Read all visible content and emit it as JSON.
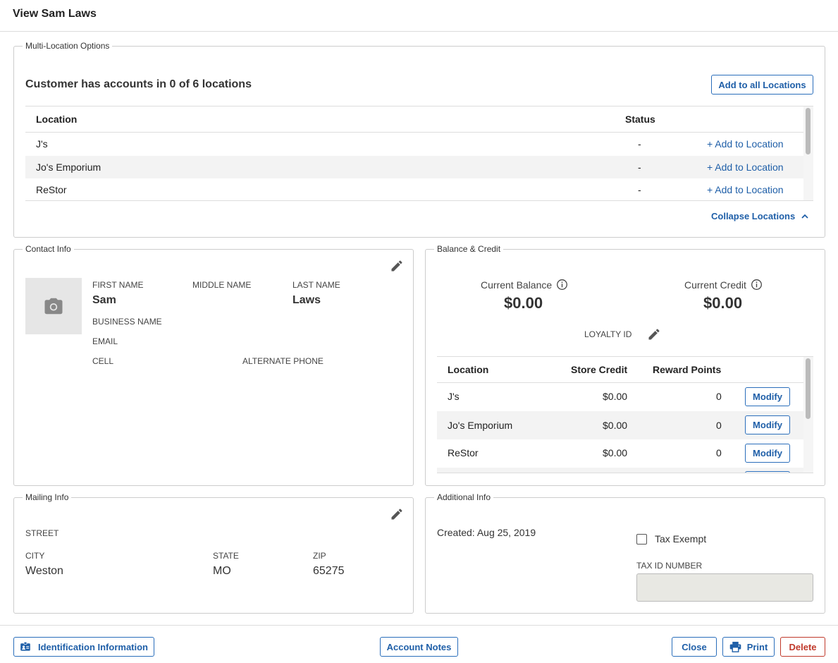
{
  "header": {
    "title": "View Sam Laws"
  },
  "multi_location": {
    "legend": "Multi-Location Options",
    "summary": "Customer has accounts in 0 of 6 locations",
    "add_all_label": "Add to all Locations",
    "columns": {
      "location": "Location",
      "status": "Status"
    },
    "rows": [
      {
        "location": "J's",
        "status": "-",
        "action": "+ Add to Location"
      },
      {
        "location": "Jo's Emporium",
        "status": "-",
        "action": "+ Add to Location"
      },
      {
        "location": "ReStor",
        "status": "-",
        "action": "+ Add to Location"
      }
    ],
    "collapse_label": "Collapse Locations"
  },
  "contact": {
    "legend": "Contact Info",
    "first_name_label": "FIRST NAME",
    "first_name": "Sam",
    "middle_name_label": "MIDDLE NAME",
    "last_name_label": "LAST NAME",
    "last_name": "Laws",
    "business_name_label": "BUSINESS NAME",
    "email_label": "EMAIL",
    "cell_label": "CELL",
    "alternate_phone_label": "ALTERNATE PHONE"
  },
  "balance": {
    "legend": "Balance & Credit",
    "current_balance_label": "Current Balance",
    "current_balance": "$0.00",
    "current_credit_label": "Current Credit",
    "current_credit": "$0.00",
    "loyalty_id_label": "LOYALTY ID",
    "columns": {
      "location": "Location",
      "store_credit": "Store Credit",
      "reward_points": "Reward Points"
    },
    "rows": [
      {
        "location": "J's",
        "store_credit": "$0.00",
        "reward_points": "0",
        "action": "Modify"
      },
      {
        "location": "Jo's Emporium",
        "store_credit": "$0.00",
        "reward_points": "0",
        "action": "Modify"
      },
      {
        "location": "ReStor",
        "store_credit": "$0.00",
        "reward_points": "0",
        "action": "Modify"
      }
    ]
  },
  "mailing": {
    "legend": "Mailing Info",
    "street_label": "STREET",
    "city_label": "CITY",
    "city": "Weston",
    "state_label": "STATE",
    "state": "MO",
    "zip_label": "ZIP",
    "zip": "65275"
  },
  "additional": {
    "legend": "Additional Info",
    "created": "Created: Aug 25, 2019",
    "tax_exempt_label": "Tax Exempt",
    "tax_id_label": "TAX ID NUMBER",
    "tax_id_value": ""
  },
  "footer": {
    "identification_label": "Identification Information",
    "account_notes_label": "Account Notes",
    "close_label": "Close",
    "print_label": "Print",
    "delete_label": "Delete"
  },
  "colors": {
    "accent": "#1f5fa8",
    "danger": "#c0392b"
  }
}
